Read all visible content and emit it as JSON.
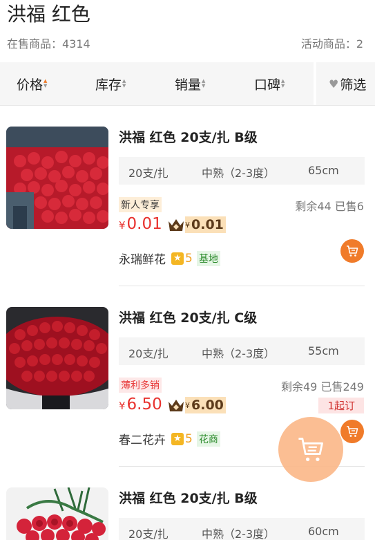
{
  "header": {
    "title": "洪福 红色",
    "on_sale_label": "在售商品：4314",
    "activity_label": "活动商品：2"
  },
  "filters": {
    "price": "价格",
    "stock": "库存",
    "sales": "销量",
    "rating": "口碑",
    "screen": "筛选",
    "active_color": "#f07c2c"
  },
  "items": [
    {
      "name": "洪福 红色 20支/扎 B级",
      "spec_qty": "20支/扎",
      "spec_ripe": "中熟（2-3度）",
      "spec_len": "65cm",
      "tag": "新人专享",
      "stock": "剩余44 已售6",
      "price_symbol": "¥",
      "price": "0.01",
      "vip_symbol": "¥",
      "vip_price": "0.01",
      "shop": "永瑞鲜花",
      "score": "5",
      "shop_type": "基地"
    },
    {
      "name": "洪福 红色 20支/扎 C级",
      "spec_qty": "20支/扎",
      "spec_ripe": "中熟（2-3度）",
      "spec_len": "55cm",
      "tag": "薄利多销",
      "stock": "剩余49 已售249",
      "min_order": "1起订",
      "price_symbol": "¥",
      "price": "6.50",
      "vip_symbol": "¥",
      "vip_price": "6.00",
      "shop": "春二花卉",
      "score": "5",
      "shop_type": "花商"
    },
    {
      "name": "洪福 红色 20支/扎 B级",
      "spec_qty": "20支/扎",
      "spec_ripe": "中熟（2-3度）",
      "spec_len": "60cm"
    }
  ],
  "colors": {
    "accent": "#f07b2a",
    "price": "#e8322e",
    "vip_bg": "#fbe0b8"
  }
}
